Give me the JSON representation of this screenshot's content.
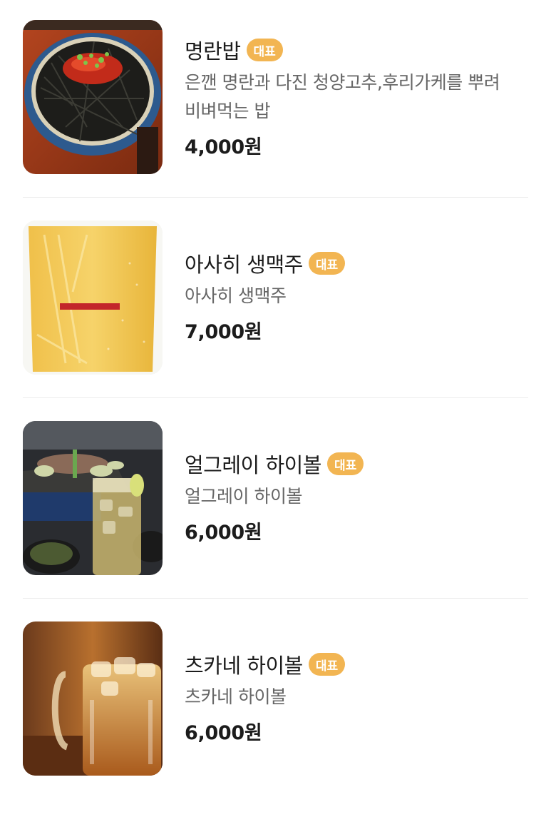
{
  "menu": {
    "items": [
      {
        "name": "명란밥",
        "badge": "대표",
        "description": "은깬 명란과 다진 청양고추,후리가케를 뿌려 비벼먹는 밥",
        "price": "4,000원",
        "image": "mentaiko-rice-bowl-photo"
      },
      {
        "name": "아사히 생맥주",
        "badge": "대표",
        "description": "아사히 생맥주",
        "price": "7,000원",
        "image": "asahi-draft-beer-photo"
      },
      {
        "name": "얼그레이 하이볼",
        "badge": "대표",
        "description": "얼그레이 하이볼",
        "price": "6,000원",
        "image": "earl-grey-highball-photo"
      },
      {
        "name": "츠카네 하이볼",
        "badge": "대표",
        "description": "츠카네 하이볼",
        "price": "6,000원",
        "image": "tsukane-highball-photo"
      }
    ]
  },
  "colors": {
    "badge_bg": "#f2b552",
    "text_primary": "#1c1c1c",
    "text_secondary": "#666666",
    "divider": "#ececec"
  }
}
